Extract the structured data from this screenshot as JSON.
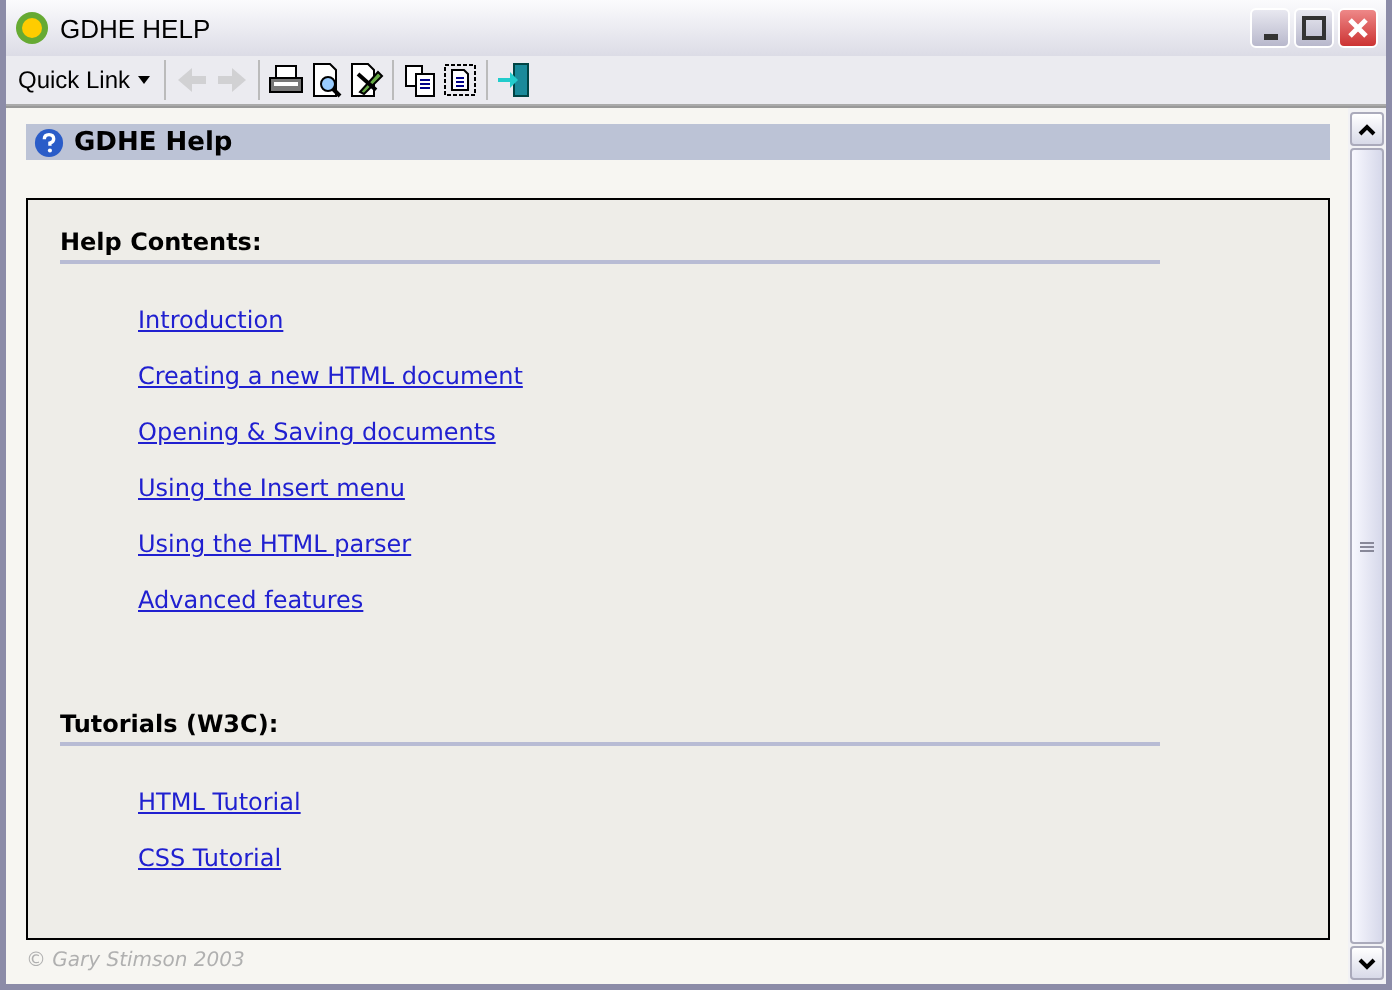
{
  "window": {
    "title": "GDHE HELP"
  },
  "toolbar": {
    "quick_link": "Quick Link",
    "buttons": [
      {
        "kind": "back",
        "disabled": true
      },
      {
        "kind": "forward",
        "disabled": true
      },
      {
        "kind": "print",
        "disabled": false
      },
      {
        "kind": "preview",
        "disabled": false
      },
      {
        "kind": "edit",
        "disabled": false
      },
      {
        "kind": "copy",
        "disabled": false
      },
      {
        "kind": "select",
        "disabled": false
      },
      {
        "kind": "exit",
        "disabled": false
      }
    ]
  },
  "page_title": "GDHE Help",
  "sections": [
    {
      "heading": "Help Contents:",
      "links": [
        "Introduction",
        "Creating a new HTML document",
        "Opening & Saving documents",
        "Using the Insert menu",
        "Using the HTML parser",
        "Advanced features"
      ]
    },
    {
      "heading": "Tutorials (W3C):",
      "links": [
        "HTML Tutorial",
        "CSS Tutorial"
      ]
    }
  ],
  "footer": "© Gary Stimson 2003"
}
